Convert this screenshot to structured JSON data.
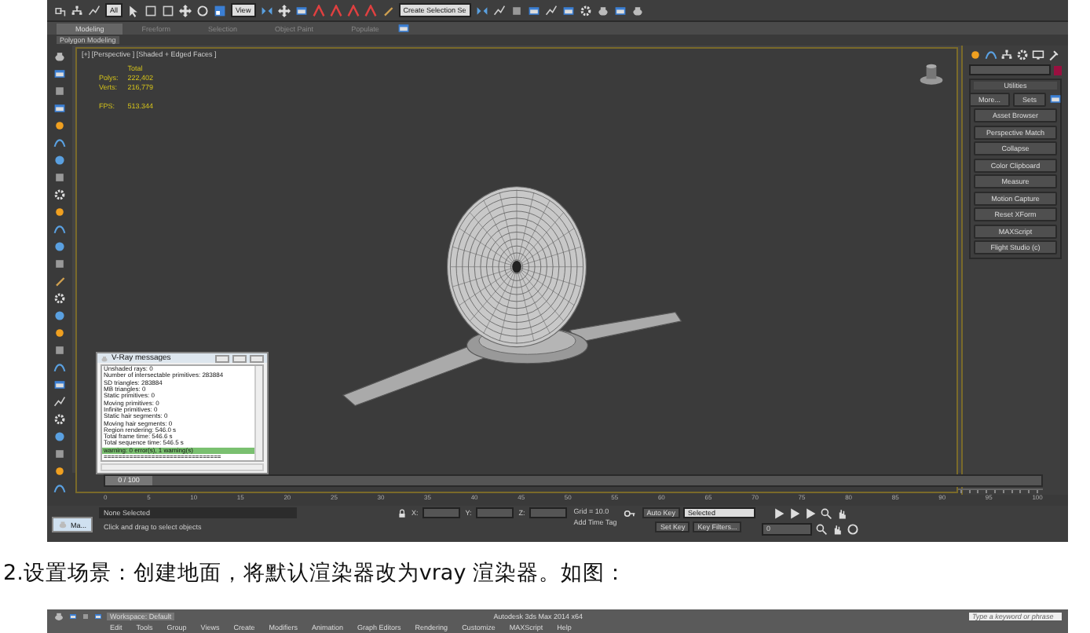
{
  "toolbar": {
    "selection_filter": "All",
    "coordinate_system": "View",
    "named_selection": "Create Selection Se"
  },
  "ribbon": {
    "tabs": [
      {
        "label": "Modeling",
        "selected": true
      },
      {
        "label": "Freeform",
        "selected": false
      },
      {
        "label": "Selection",
        "selected": false
      },
      {
        "label": "Object Paint",
        "selected": false
      },
      {
        "label": "Populate",
        "selected": false
      }
    ],
    "panel": "Polygon Modeling"
  },
  "viewport": {
    "label": "[+] [Perspective ] [Shaded + Edged Faces ]",
    "stats_header": "Total",
    "stats": [
      {
        "label": "Polys:",
        "value": "222,402"
      },
      {
        "label": "Verts:",
        "value": "216,779"
      },
      {
        "label": "FPS:",
        "value": "513.344"
      }
    ]
  },
  "vray_messages": {
    "title": "V-Ray messages",
    "lines": [
      {
        "text": "Unshaded rays: 0",
        "selected": false
      },
      {
        "text": "Number of intersectable primitives: 283884",
        "selected": false
      },
      {
        "text": "SD triangles: 283884",
        "selected": false
      },
      {
        "text": "MB triangles: 0",
        "selected": false
      },
      {
        "text": "Static primitives: 0",
        "selected": false
      },
      {
        "text": "Moving primitives: 0",
        "selected": false
      },
      {
        "text": "Infinite primitives: 0",
        "selected": false
      },
      {
        "text": "Static hair segments: 0",
        "selected": false
      },
      {
        "text": "Moving hair segments: 0",
        "selected": false
      },
      {
        "text": "Region rendering: 546.0 s",
        "selected": false
      },
      {
        "text": "Total frame time: 546.6 s",
        "selected": false
      },
      {
        "text": "Total sequence time: 546.5 s",
        "selected": false
      },
      {
        "text": "warning: 0 error(s), 1 warning(s)",
        "selected": true
      },
      {
        "text": "================================",
        "selected": false
      }
    ]
  },
  "command_panel": {
    "rollout": "Utilities",
    "top_buttons": [
      "More...",
      "Sets"
    ],
    "buttons": [
      "Asset Browser",
      "Perspective Match",
      "Collapse",
      "Color Clipboard",
      "Measure",
      "Motion Capture",
      "Reset XForm",
      "MAXScript",
      "Flight Studio (c)"
    ]
  },
  "timeline": {
    "frame": "0 / 100",
    "ticks": [
      "0",
      "5",
      "10",
      "15",
      "20",
      "25",
      "30",
      "35",
      "40",
      "45",
      "50",
      "55",
      "60",
      "65",
      "70",
      "75",
      "80",
      "85",
      "90",
      "95",
      "100"
    ]
  },
  "status": {
    "taskbar_item": "Ma...",
    "selection": "None Selected",
    "prompt": "Click and drag to select objects",
    "axes": [
      "X:",
      "Y:",
      "Z:"
    ],
    "grid": "Grid = 10.0",
    "time_tag": "Add Time Tag",
    "auto_key": "Auto Key",
    "key_mode": "Selected",
    "set_key": "Set Key",
    "key_filters": "Key Filters...",
    "frame": "0"
  },
  "caption": "2.设置场景：创建地面，将默认渲染器改为vray 渲染器。如图：",
  "next_screenshot": {
    "workspace": "Workspace: Default",
    "title": "Autodesk 3ds Max 2014 x64",
    "search_placeholder": "Type a keyword or phrase",
    "menu": [
      "Edit",
      "Tools",
      "Group",
      "Views",
      "Create",
      "Modifiers",
      "Animation",
      "Graph Editors",
      "Rendering",
      "Customize",
      "MAXScript",
      "Help"
    ]
  }
}
